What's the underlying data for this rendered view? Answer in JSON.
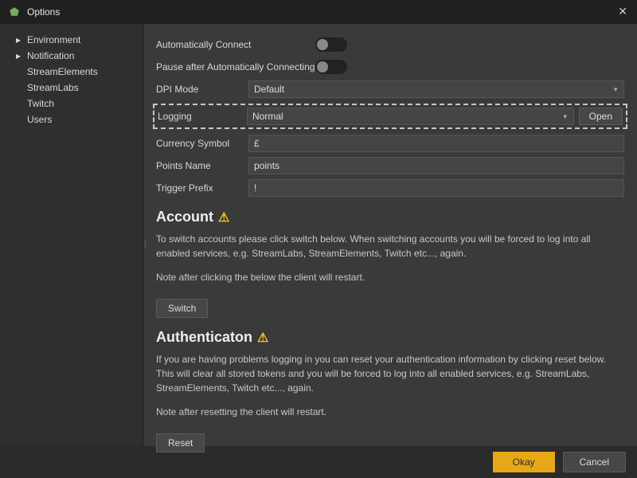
{
  "window": {
    "title": "Options"
  },
  "sidebar": {
    "items": [
      {
        "label": "Environment",
        "expandable": true
      },
      {
        "label": "Notification",
        "expandable": true
      },
      {
        "label": "StreamElements",
        "expandable": false
      },
      {
        "label": "StreamLabs",
        "expandable": false
      },
      {
        "label": "Twitch",
        "expandable": false
      },
      {
        "label": "Users",
        "expandable": false
      }
    ]
  },
  "settings": {
    "auto_connect_label": "Automatically Connect",
    "pause_label": "Pause after Automatically Connecting",
    "dpi_label": "DPI Mode",
    "dpi_value": "Default",
    "logging_label": "Logging",
    "logging_value": "Normal",
    "open_label": "Open",
    "currency_label": "Currency Symbol",
    "currency_value": "£",
    "points_label": "Points Name",
    "points_value": "points",
    "trigger_label": "Trigger Prefix",
    "trigger_value": "!"
  },
  "account": {
    "title": "Account",
    "desc": "To switch accounts please click switch below. When switching accounts you will be forced to log into all enabled services, e.g. StreamLabs, StreamElements, Twitch etc..., again.",
    "note": "Note after clicking the below the client will restart.",
    "switch_label": "Switch"
  },
  "auth": {
    "title": "Authenticaton",
    "desc": "If you are having problems logging in you can reset your authentication information by clicking reset below. This will clear all stored tokens and you will be forced to log into all enabled services, e.g. StreamLabs, StreamElements, Twitch etc..., again.",
    "note": "Note after resetting the client will restart.",
    "reset_label": "Reset"
  },
  "footer": {
    "ok": "Okay",
    "cancel": "Cancel"
  }
}
